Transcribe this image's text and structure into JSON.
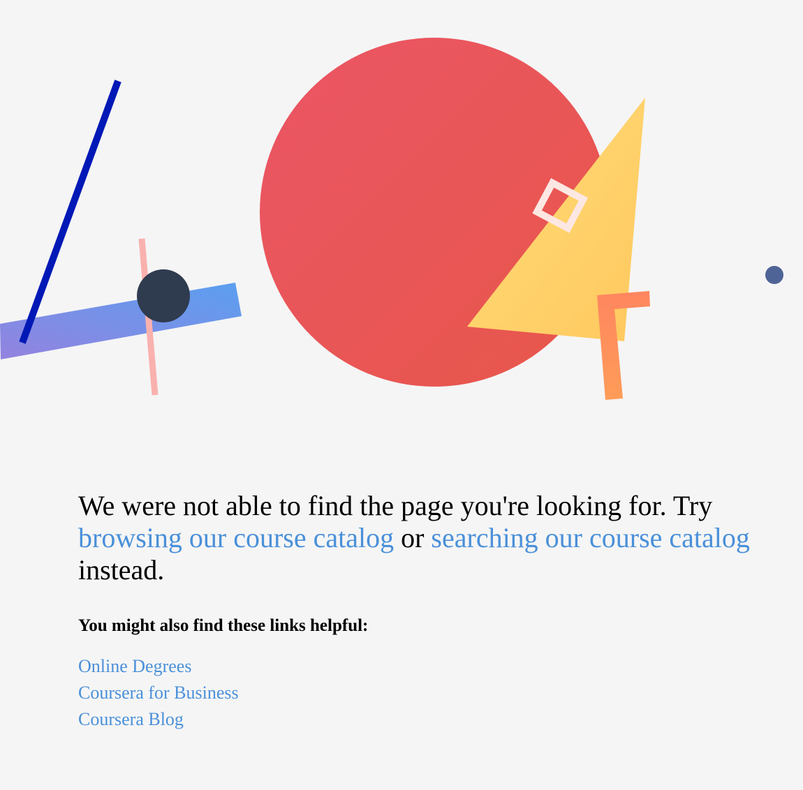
{
  "illustration": {
    "label": "404 page illustration",
    "colors": {
      "circle_start": "#ea5565",
      "circle_end": "#e8574a",
      "triangle_start": "#ffdd7a",
      "triangle_end": "#ffc85e",
      "band_start": "#9383df",
      "band_end": "#5b9ff0",
      "blue_line": "#0019b6",
      "pink_line": "#f9b1ae",
      "dark_dot": "#2f3b4f",
      "small_dot": "#4f6496",
      "corner_start": "#ff8660",
      "corner_end": "#ff9c58",
      "square_outline": "#fde7e3"
    }
  },
  "message": {
    "text_before": "We were not able to find the page you're looking for. Try ",
    "browse_link": "browsing our course catalog",
    "text_middle": " or ",
    "search_link": "searching our course catalog",
    "text_after": " instead."
  },
  "helpful": {
    "heading": "You might also find these links helpful:",
    "links": [
      {
        "label": "Online Degrees"
      },
      {
        "label": "Coursera for Business"
      },
      {
        "label": "Coursera Blog"
      }
    ]
  }
}
